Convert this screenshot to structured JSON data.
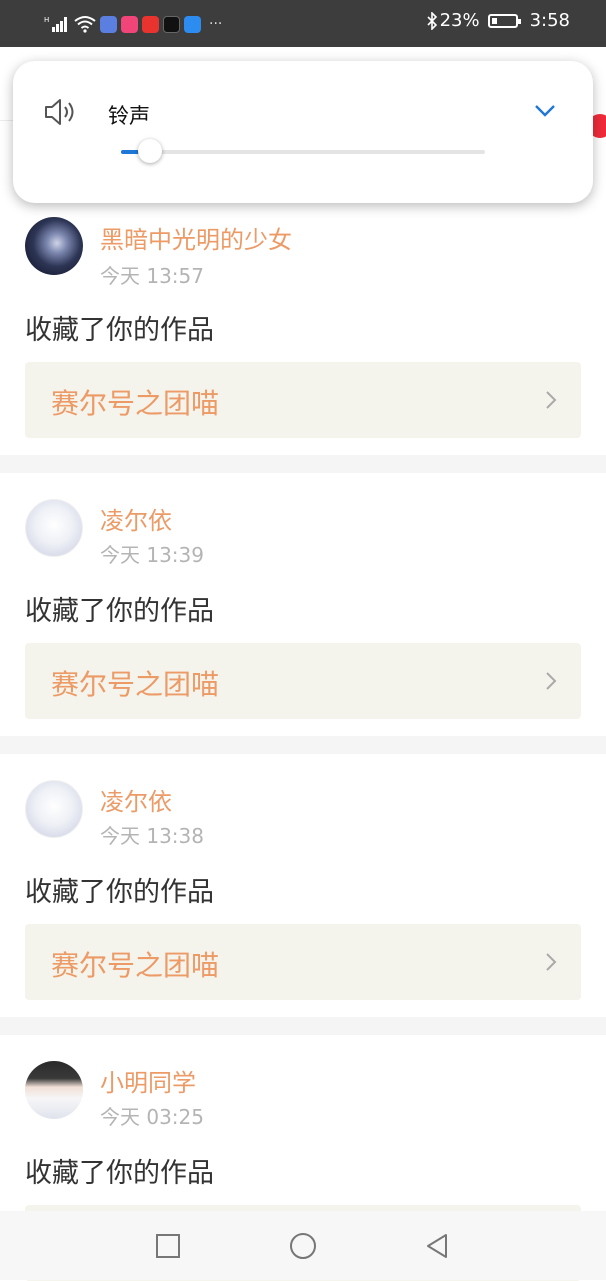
{
  "status_bar": {
    "battery_percent": "23%",
    "time": "3:58",
    "overflow": "···"
  },
  "volume_popup": {
    "label": "铃声",
    "level": 0.08,
    "accent_color": "#1f78d8"
  },
  "notifications": [
    {
      "username": "黑暗中光明的少女",
      "time": "今天 13:57",
      "action": "收藏了你的作品",
      "work_title": "赛尔号之团喵"
    },
    {
      "username": "凌尔依",
      "time": "今天 13:39",
      "action": "收藏了你的作品",
      "work_title": "赛尔号之团喵"
    },
    {
      "username": "凌尔依",
      "time": "今天 13:38",
      "action": "收藏了你的作品",
      "work_title": "赛尔号之团喵"
    },
    {
      "username": "小明同学",
      "time": "今天 03:25",
      "action": "收藏了你的作品",
      "work_title": ""
    }
  ],
  "nav_bar": {
    "icons": [
      "recents-icon",
      "home-icon",
      "back-icon"
    ]
  },
  "colors": {
    "username": "#ec9a66",
    "work_box_bg": "#f5f4ec",
    "separator": "#f5f5f5"
  }
}
